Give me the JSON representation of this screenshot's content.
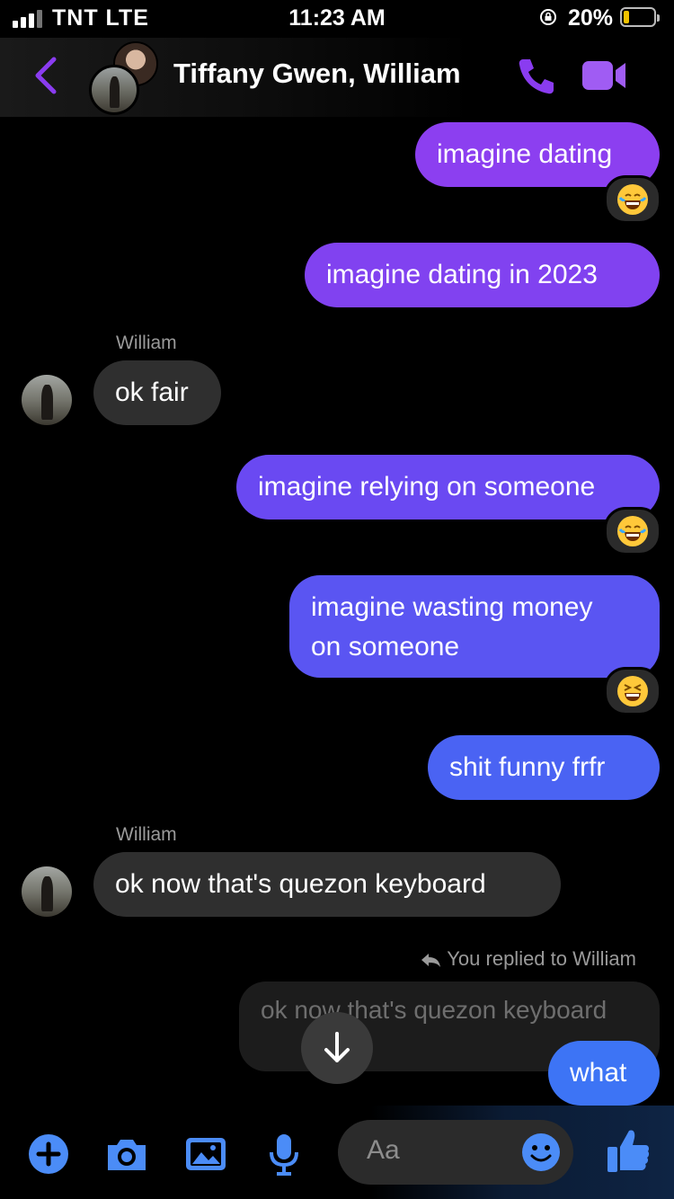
{
  "status_bar": {
    "carrier": "TNT  LTE",
    "time": "11:23 AM",
    "battery_percent": "20%",
    "battery_level": 0.2
  },
  "header": {
    "title": "Tiffany Gwen, William"
  },
  "messages": [
    {
      "from": "me",
      "text": "imagine dating",
      "reaction": "laughing-tears-emoji"
    },
    {
      "from": "me",
      "text": "imagine dating in 2023"
    },
    {
      "sender": "William",
      "from": "them",
      "text": "ok fair"
    },
    {
      "from": "me",
      "text": "imagine relying on someone",
      "reaction": "laughing-tears-emoji"
    },
    {
      "from": "me",
      "text_line1": "imagine wasting money",
      "text_line2": "on someone",
      "reaction": "grinning-squint-emoji"
    },
    {
      "from": "me",
      "text": "shit funny frfr"
    },
    {
      "sender": "William",
      "from": "them",
      "text": "ok now that's quezon keyboard"
    },
    {
      "reply_note": "You replied to William",
      "quoted": "ok now that's quezon keyboard",
      "from": "me",
      "text": "what"
    }
  ],
  "composer": {
    "placeholder": "Aa"
  },
  "colors": {
    "accent": "#7b3cf6",
    "bubble_top": "#8e3ff0",
    "bubble_bottom": "#3f6cf3",
    "them_bubble": "#2f2f2f"
  }
}
